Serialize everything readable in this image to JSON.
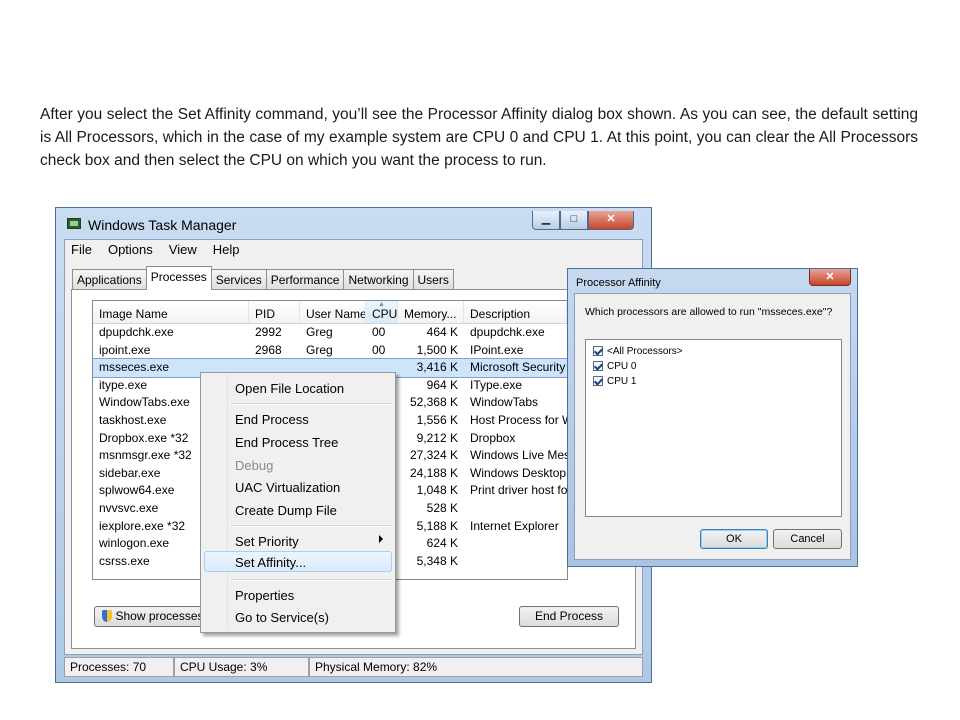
{
  "caption": "After you select the Set Affinity command, you’ll see the Processor Affinity dialog box shown. As you can see, the default setting is All Processors, which in the case of my example system are CPU 0 and CPU 1. At this point, you can clear the All Processors check box and then select the CPU on which you want the process to run.",
  "task_manager": {
    "title": "Windows Task Manager",
    "menu": [
      "File",
      "Options",
      "View",
      "Help"
    ],
    "tabs": [
      "Applications",
      "Processes",
      "Services",
      "Performance",
      "Networking",
      "Users"
    ],
    "active_tab": "Processes",
    "columns": [
      "Image Name",
      "PID",
      "User Name",
      "CPU",
      "Memory...",
      "Description"
    ],
    "rows": [
      [
        "dpupdchk.exe",
        "2992",
        "Greg",
        "00",
        "464 K",
        "dpupdchk.exe"
      ],
      [
        "ipoint.exe",
        "2968",
        "Greg",
        "00",
        "1,500 K",
        "IPoint.exe"
      ],
      [
        "msseces.exe",
        "",
        "",
        "",
        "3,416 K",
        "Microsoft Security"
      ],
      [
        "itype.exe",
        "",
        "",
        "",
        "964 K",
        "IType.exe"
      ],
      [
        "WindowTabs.exe",
        "",
        "",
        "",
        "52,368 K",
        "WindowTabs"
      ],
      [
        "taskhost.exe",
        "",
        "",
        "",
        "1,556 K",
        "Host Process for W"
      ],
      [
        "Dropbox.exe *32",
        "",
        "",
        "",
        "9,212 K",
        "Dropbox"
      ],
      [
        "msnmsgr.exe *32",
        "",
        "",
        "",
        "27,324 K",
        "Windows Live Mes"
      ],
      [
        "sidebar.exe",
        "",
        "",
        "",
        "24,188 K",
        "Windows Desktop"
      ],
      [
        "splwow64.exe",
        "",
        "",
        "",
        "1,048 K",
        "Print driver host fo"
      ],
      [
        "nvvsvc.exe",
        "",
        "",
        "",
        "528 K",
        ""
      ],
      [
        "iexplore.exe *32",
        "",
        "",
        "",
        "5,188 K",
        "Internet Explorer"
      ],
      [
        "winlogon.exe",
        "",
        "",
        "",
        "624 K",
        ""
      ],
      [
        "csrss.exe",
        "",
        "",
        "",
        "5,348 K",
        ""
      ]
    ],
    "show_processes": "Show processes",
    "end_process": "End Process",
    "status": {
      "processes": "Processes: 70",
      "cpu": "CPU Usage: 3%",
      "memory": "Physical Memory: 82%"
    }
  },
  "context_menu": {
    "open_file_location": "Open File Location",
    "end_process": "End Process",
    "end_process_tree": "End Process Tree",
    "debug": "Debug",
    "uac_virtualization": "UAC Virtualization",
    "create_dump_file": "Create Dump File",
    "set_priority": "Set Priority",
    "set_affinity": "Set Affinity...",
    "properties": "Properties",
    "go_to_services": "Go to Service(s)"
  },
  "affinity_dialog": {
    "title": "Processor Affinity",
    "question": "Which processors are allowed to run \"msseces.exe\"?",
    "options": [
      "<All Processors>",
      "CPU 0",
      "CPU 1"
    ],
    "ok": "OK",
    "cancel": "Cancel"
  },
  "icons": {
    "app": "task-manager-icon",
    "shield": "uac-shield-icon"
  }
}
